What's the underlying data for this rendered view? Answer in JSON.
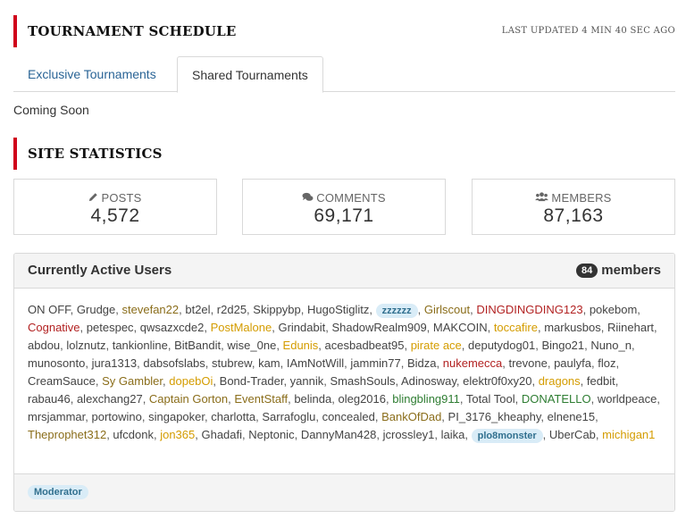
{
  "tournament": {
    "title": "TOURNAMENT SCHEDULE",
    "updated": "LAST UPDATED 4 MIN 40 SEC AGO",
    "tabs": [
      {
        "label": "Exclusive Tournaments",
        "active": false
      },
      {
        "label": "Shared Tournaments",
        "active": true
      }
    ],
    "content": "Coming Soon"
  },
  "stats": {
    "title": "SITE STATISTICS",
    "posts": {
      "label": "POSTS",
      "value": "4,572",
      "icon": "pencil-icon"
    },
    "comments": {
      "label": "COMMENTS",
      "value": "69,171",
      "icon": "comments-icon"
    },
    "members": {
      "label": "MEMBERS",
      "value": "87,163",
      "icon": "users-icon"
    }
  },
  "active_users": {
    "title": "Currently Active Users",
    "count": "84",
    "count_label": "members",
    "users": [
      {
        "name": "ON OFF",
        "color": "default"
      },
      {
        "name": "Grudge",
        "color": "default"
      },
      {
        "name": "stevefan22",
        "color": "olive"
      },
      {
        "name": "bt2el",
        "color": "default"
      },
      {
        "name": "r2d25",
        "color": "default"
      },
      {
        "name": "Skippybp",
        "color": "default"
      },
      {
        "name": "HugoStiglitz",
        "color": "default"
      },
      {
        "name": "zzzzzz",
        "color": "pill"
      },
      {
        "name": "Girlscout",
        "color": "olive"
      },
      {
        "name": "DINGDINGDING123",
        "color": "red"
      },
      {
        "name": "pokebom",
        "color": "default"
      },
      {
        "name": "Cognative",
        "color": "red"
      },
      {
        "name": "petespec",
        "color": "default"
      },
      {
        "name": "qwsazxcde2",
        "color": "default"
      },
      {
        "name": "PostMalone",
        "color": "gold"
      },
      {
        "name": "Grindabit",
        "color": "default"
      },
      {
        "name": "ShadowRealm909",
        "color": "default"
      },
      {
        "name": "MAKCOIN",
        "color": "default"
      },
      {
        "name": "toccafire",
        "color": "gold"
      },
      {
        "name": "markusbos",
        "color": "default"
      },
      {
        "name": "Riinehart",
        "color": "default"
      },
      {
        "name": "abdou",
        "color": "default"
      },
      {
        "name": "lolznutz",
        "color": "default"
      },
      {
        "name": "tankionline",
        "color": "default"
      },
      {
        "name": "BitBandit",
        "color": "default"
      },
      {
        "name": "wise_0ne",
        "color": "default"
      },
      {
        "name": "Edunis",
        "color": "gold"
      },
      {
        "name": "acesbadbeat95",
        "color": "default"
      },
      {
        "name": "pirate ace",
        "color": "gold"
      },
      {
        "name": "deputydog01",
        "color": "default"
      },
      {
        "name": "Bingo21",
        "color": "default"
      },
      {
        "name": "Nuno_n",
        "color": "default"
      },
      {
        "name": "munosonto",
        "color": "default"
      },
      {
        "name": "jura1313",
        "color": "default"
      },
      {
        "name": "dabsofslabs",
        "color": "default"
      },
      {
        "name": "stubrew",
        "color": "default"
      },
      {
        "name": "kam",
        "color": "default"
      },
      {
        "name": "IAmNotWill",
        "color": "default"
      },
      {
        "name": "jammin77",
        "color": "default"
      },
      {
        "name": "Bidza",
        "color": "default"
      },
      {
        "name": "nukemecca",
        "color": "red"
      },
      {
        "name": "trevone",
        "color": "default"
      },
      {
        "name": "paulyfa",
        "color": "default"
      },
      {
        "name": "floz",
        "color": "default"
      },
      {
        "name": "CreamSauce",
        "color": "default"
      },
      {
        "name": "Sy Gambler",
        "color": "olive"
      },
      {
        "name": "dopebOi",
        "color": "gold"
      },
      {
        "name": "Bond-Trader",
        "color": "default"
      },
      {
        "name": "yannik",
        "color": "default"
      },
      {
        "name": "SmashSouls",
        "color": "default"
      },
      {
        "name": "Adinosway",
        "color": "default"
      },
      {
        "name": "elektr0f0xy20",
        "color": "default"
      },
      {
        "name": "dragons",
        "color": "gold"
      },
      {
        "name": "fedbit",
        "color": "default"
      },
      {
        "name": "rabau46",
        "color": "default"
      },
      {
        "name": "alexchang27",
        "color": "default"
      },
      {
        "name": "Captain Gorton",
        "color": "olive"
      },
      {
        "name": "EventStaff",
        "color": "olive"
      },
      {
        "name": "belinda",
        "color": "default"
      },
      {
        "name": "oleg2016",
        "color": "default"
      },
      {
        "name": "blingbling911",
        "color": "green"
      },
      {
        "name": "Total Tool",
        "color": "default"
      },
      {
        "name": "DONATELLO",
        "color": "green"
      },
      {
        "name": "worldpeace",
        "color": "default"
      },
      {
        "name": "mrsjammar",
        "color": "default"
      },
      {
        "name": "portowino",
        "color": "default"
      },
      {
        "name": "singapoker",
        "color": "default"
      },
      {
        "name": "charlotta",
        "color": "default"
      },
      {
        "name": "Sarrafoglu",
        "color": "default"
      },
      {
        "name": "concealed",
        "color": "default"
      },
      {
        "name": "BankOfDad",
        "color": "olive"
      },
      {
        "name": "PI_3176_kheaphy",
        "color": "default"
      },
      {
        "name": "elnene15",
        "color": "default"
      },
      {
        "name": "Theprophet312",
        "color": "olive"
      },
      {
        "name": "ufcdonk",
        "color": "default"
      },
      {
        "name": "jon365",
        "color": "gold"
      },
      {
        "name": "Ghadafi",
        "color": "default"
      },
      {
        "name": "Neptonic",
        "color": "default"
      },
      {
        "name": "DannyMan428",
        "color": "default"
      },
      {
        "name": "jcrossley1",
        "color": "default"
      },
      {
        "name": "laika",
        "color": "default"
      },
      {
        "name": "plo8monster",
        "color": "pill"
      },
      {
        "name": "UberCab",
        "color": "default"
      },
      {
        "name": "michigan1",
        "color": "gold"
      }
    ],
    "footer_badge": "Moderator"
  }
}
